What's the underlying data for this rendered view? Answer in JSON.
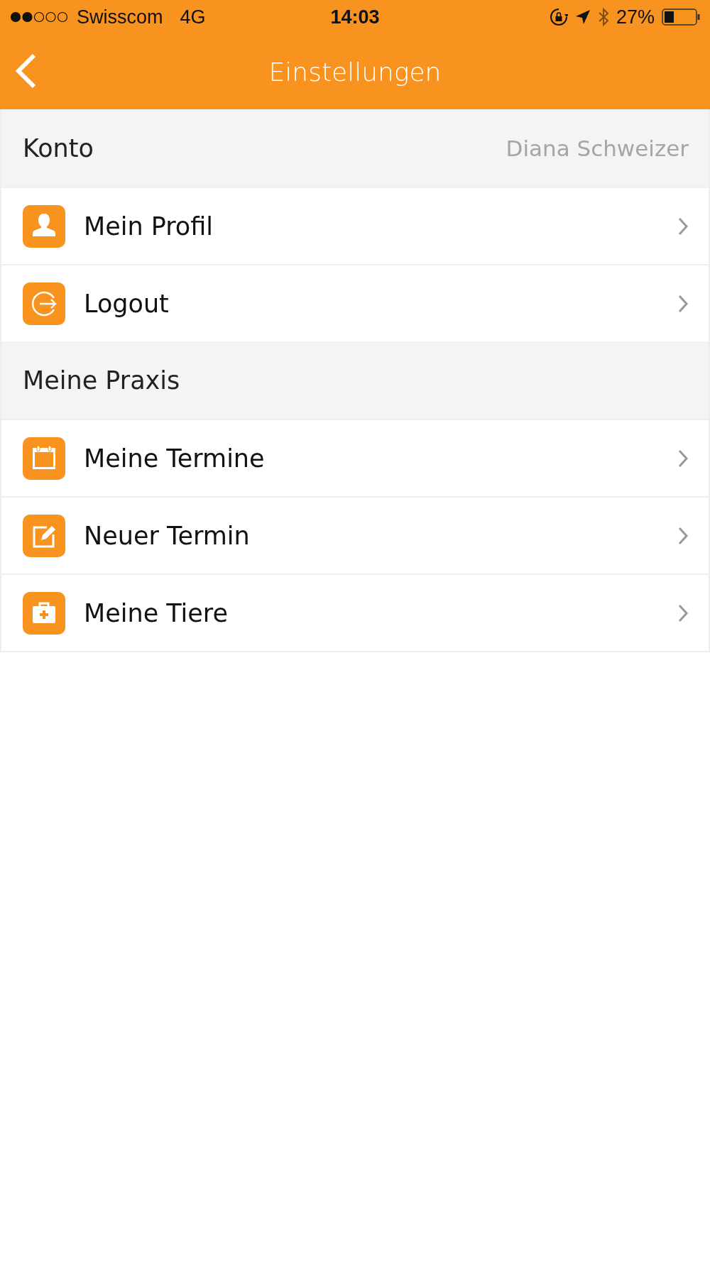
{
  "status_bar": {
    "carrier": "Swisscom",
    "network": "4G",
    "time": "14:03",
    "battery": "27%"
  },
  "nav_bar": {
    "title": "Einstellungen"
  },
  "sections": [
    {
      "title": "Konto",
      "value": "Diana Schweizer",
      "items": [
        {
          "kind": "profile",
          "label": "Mein Profil"
        },
        {
          "kind": "logout",
          "label": "Logout"
        }
      ]
    },
    {
      "title": "Meine Praxis",
      "items": [
        {
          "kind": "calendar",
          "label": "Meine Termine"
        },
        {
          "kind": "edit",
          "label": "Neuer Termin"
        },
        {
          "kind": "kit",
          "label": "Meine Tiere"
        }
      ]
    }
  ]
}
